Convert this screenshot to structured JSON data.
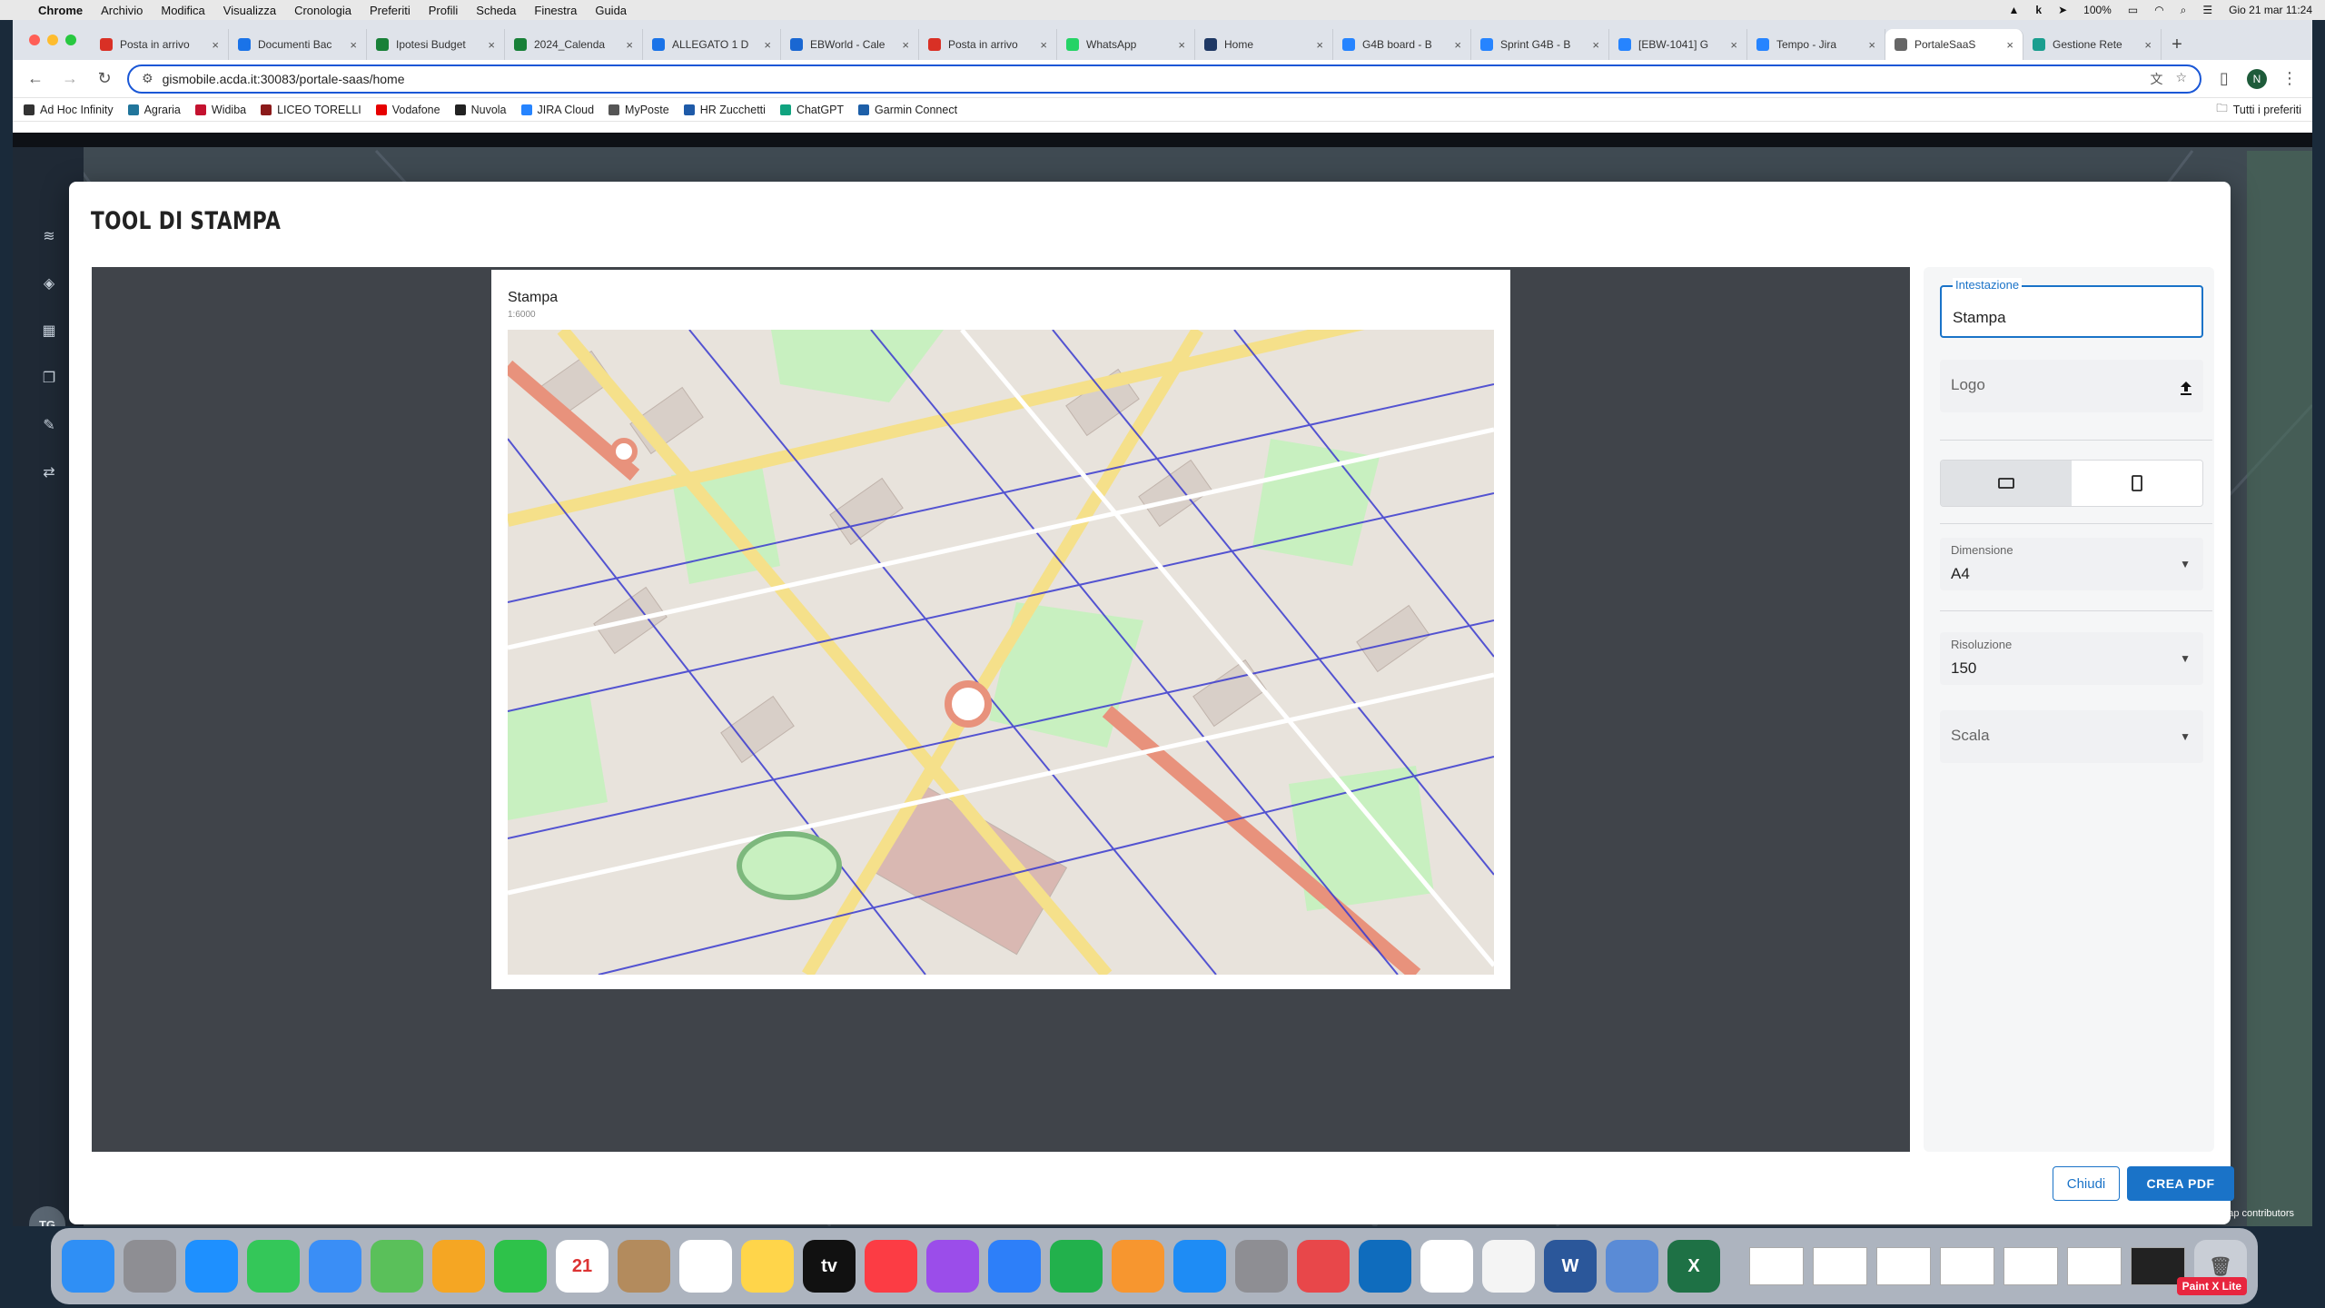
{
  "menubar": {
    "app": "Chrome",
    "items": [
      "Archivio",
      "Modifica",
      "Visualizza",
      "Cronologia",
      "Preferiti",
      "Profili",
      "Scheda",
      "Finestra",
      "Guida"
    ],
    "battery": "100%",
    "datetime": "Gio 21 mar  11:24"
  },
  "tabs": [
    {
      "label": "Posta in arrivo",
      "color": "#d93025"
    },
    {
      "label": "Documenti Bac",
      "color": "#1a73e8"
    },
    {
      "label": "Ipotesi Budget",
      "color": "#188038"
    },
    {
      "label": "2024_Calenda",
      "color": "#188038"
    },
    {
      "label": "ALLEGATO 1 D",
      "color": "#1a73e8"
    },
    {
      "label": "EBWorld - Cale",
      "color": "#1967d2"
    },
    {
      "label": "Posta in arrivo",
      "color": "#d93025"
    },
    {
      "label": "WhatsApp",
      "color": "#25d366"
    },
    {
      "label": "Home",
      "color": "#1f3864"
    },
    {
      "label": "G4B board - B",
      "color": "#2684ff"
    },
    {
      "label": "Sprint G4B - B",
      "color": "#2684ff"
    },
    {
      "label": "[EBW-1041] G",
      "color": "#2684ff"
    },
    {
      "label": "Tempo - Jira",
      "color": "#2684ff"
    },
    {
      "label": "PortaleSaaS",
      "color": "#666666",
      "active": true
    },
    {
      "label": "Gestione Rete",
      "color": "#1a9e8f"
    }
  ],
  "address": "gismobile.acda.it:30083/portale-saas/home",
  "profile_initial": "N",
  "bookmarks": [
    {
      "label": "Ad Hoc Infinity",
      "color": "#333333"
    },
    {
      "label": "Agraria",
      "color": "#21759b"
    },
    {
      "label": "Widiba",
      "color": "#c4122f"
    },
    {
      "label": "LICEO TORELLI",
      "color": "#8b1a1a"
    },
    {
      "label": "Vodafone",
      "color": "#e60000"
    },
    {
      "label": "Nuvola",
      "color": "#222222"
    },
    {
      "label": "JIRA Cloud",
      "color": "#2684ff"
    },
    {
      "label": "MyPoste",
      "color": "#555555"
    },
    {
      "label": "HR Zucchetti",
      "color": "#1e5aa8"
    },
    {
      "label": "ChatGPT",
      "color": "#10a37f"
    },
    {
      "label": "Garmin Connect",
      "color": "#1d5fa8"
    }
  ],
  "all_bookmarks": "Tutti i preferiti",
  "rail_icons": [
    "layers-icon",
    "stack-icon",
    "table-icon",
    "copy-icon",
    "wrench-icon",
    "route-icon"
  ],
  "user_initials": "TG",
  "osm_credit": "© OpenStreetMap contributors",
  "modal": {
    "title": "TOOL DI STAMPA",
    "sheet_title": "Stampa",
    "sheet_scale": "1:6000",
    "fields": {
      "intestazione": {
        "label": "Intestazione",
        "value": "Stampa"
      },
      "logo": {
        "placeholder": "Logo"
      },
      "dimensione": {
        "label": "Dimensione",
        "value": "A4"
      },
      "risoluzione": {
        "label": "Risoluzione",
        "value": "150"
      },
      "scala": {
        "placeholder": "Scala"
      }
    },
    "orientation_selected": "landscape",
    "buttons": {
      "close": "Chiudi",
      "create_pdf": "CREA PDF"
    }
  },
  "dock": {
    "apps": [
      {
        "name": "Finder",
        "color": "#2f8ff5",
        "glyph": ""
      },
      {
        "name": "Launchpad",
        "color": "#8e8e93",
        "glyph": ""
      },
      {
        "name": "Safari",
        "color": "#1e90ff",
        "glyph": ""
      },
      {
        "name": "Messages",
        "color": "#34c759",
        "glyph": ""
      },
      {
        "name": "Mail",
        "color": "#3a8ef6",
        "glyph": ""
      },
      {
        "name": "Maps",
        "color": "#5ac05a",
        "glyph": ""
      },
      {
        "name": "Photos",
        "color": "#f5a623",
        "glyph": ""
      },
      {
        "name": "FaceTime",
        "color": "#2ec24a",
        "glyph": ""
      },
      {
        "name": "Calendar",
        "color": "#ffffff",
        "glyph": "21"
      },
      {
        "name": "Contacts",
        "color": "#b38b5d",
        "glyph": ""
      },
      {
        "name": "Reminders",
        "color": "#ffffff",
        "glyph": ""
      },
      {
        "name": "Notes",
        "color": "#ffd54a",
        "glyph": ""
      },
      {
        "name": "TV",
        "color": "#111111",
        "glyph": "tv"
      },
      {
        "name": "Music",
        "color": "#fc3c44",
        "glyph": ""
      },
      {
        "name": "Podcasts",
        "color": "#9b4dea",
        "glyph": ""
      },
      {
        "name": "Keynote",
        "color": "#2d7ff9",
        "glyph": ""
      },
      {
        "name": "Numbers",
        "color": "#22b14c",
        "glyph": ""
      },
      {
        "name": "Pages",
        "color": "#f7962f",
        "glyph": ""
      },
      {
        "name": "App Store",
        "color": "#1e8cf5",
        "glyph": ""
      },
      {
        "name": "System Settings",
        "color": "#8e8e93",
        "glyph": ""
      },
      {
        "name": "AnyDesk",
        "color": "#e8474a",
        "glyph": ""
      },
      {
        "name": "Outlook",
        "color": "#0f6cbd",
        "glyph": ""
      },
      {
        "name": "Slack",
        "color": "#ffffff",
        "glyph": ""
      },
      {
        "name": "Chrome",
        "color": "#f4f4f4",
        "glyph": ""
      },
      {
        "name": "Word",
        "color": "#2b579a",
        "glyph": "W"
      },
      {
        "name": "Preview",
        "color": "#5a8bd6",
        "glyph": ""
      },
      {
        "name": "Excel",
        "color": "#1e7145",
        "glyph": "X"
      }
    ],
    "paint_label": "Paint X Lite"
  }
}
